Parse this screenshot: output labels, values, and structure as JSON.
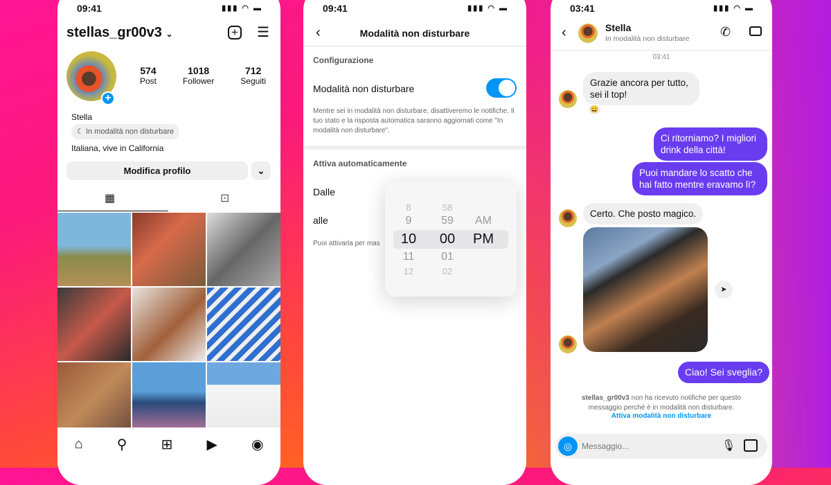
{
  "phone1": {
    "time": "09:41",
    "username": "stellas_gr00v3",
    "stats": [
      {
        "value": "574",
        "label": "Post"
      },
      {
        "value": "1018",
        "label": "Follower"
      },
      {
        "value": "712",
        "label": "Seguiti"
      }
    ],
    "name": "Stella",
    "status": "In modalità non disturbare",
    "bio": "Italiana, vive in California",
    "edit_button": "Modifica profilo"
  },
  "phone2": {
    "time": "09:41",
    "title": "Modalità non disturbare",
    "section1": "Configurazione",
    "toggle_label": "Modalità non disturbare",
    "toggle_on": true,
    "description": "Mentre sei in modalità non disturbare, disattiveremo le notifiche. Il tuo stato e la risposta automatica saranno aggiornati come \"In modalità non disturbare\".",
    "section2": "Attiva automaticamente",
    "from_label": "Dalle",
    "to_label": "alle",
    "hint": "Puoi attivarla per mas",
    "picker": {
      "hours": [
        "8",
        "9",
        "10",
        "11",
        "12"
      ],
      "minutes": [
        "58",
        "59",
        "00",
        "01",
        "02"
      ],
      "ampm": [
        "AM",
        "PM"
      ]
    }
  },
  "phone3": {
    "time": "03:41",
    "contact": "Stella",
    "contact_status": "In modalità non disturbare",
    "timestamp": "03:41",
    "messages": [
      {
        "text": "Grazie ancora per tutto, sei il top!",
        "reaction": "😀"
      },
      {
        "text": "Ci ritorniamo? I migliori drink della città!"
      },
      {
        "text": "Puoi mandare lo scatto che hai fatto mentre eravamo lì?"
      },
      {
        "text": "Certo. Che posto magico."
      },
      {
        "text": "Ciao! Sei sveglia?"
      }
    ],
    "notice_user": "stellas_gr00v3",
    "notice": " non ha ricevuto notifiche per questo messaggio perché è in modalità non disturbare.",
    "notice_link": "Attiva modalità non disturbare",
    "input_placeholder": "Messaggio..."
  },
  "colors": {
    "accent": "#0095f6",
    "sent_bubble": "#6a3cf0",
    "toggle": "#0095f6"
  }
}
